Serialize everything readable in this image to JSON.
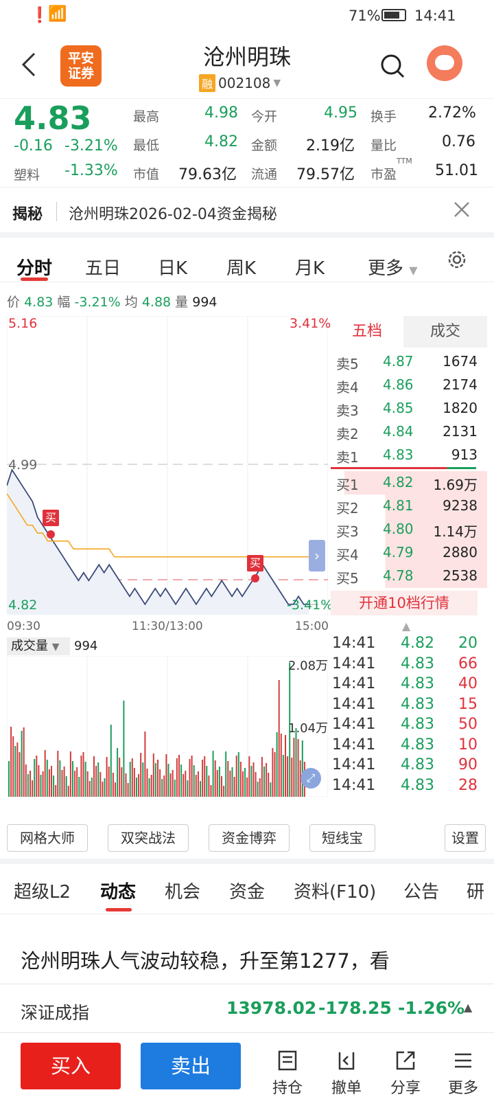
{
  "status_bar": {
    "battery": "71%",
    "time": "14:41"
  },
  "header": {
    "title": "沧州明珠",
    "rong": "融",
    "code": "002108",
    "logo_line1": "平安",
    "logo_line2": "证券"
  },
  "quote": {
    "price": "4.83",
    "change": "-0.16",
    "change_pct": "-3.21%",
    "sector": "塑料",
    "sector_pct": "-1.33%",
    "high_label": "最高",
    "high": "4.98",
    "low_label": "最低",
    "low": "4.82",
    "mcap_label": "市值",
    "mcap": "79.63亿",
    "open_label": "今开",
    "open": "4.95",
    "amount_label": "金额",
    "amount": "2.19亿",
    "float_label": "流通",
    "float": "79.57亿",
    "turnover_label": "换手",
    "turnover": "2.72%",
    "vol_ratio_label": "量比",
    "vol_ratio": "0.76",
    "pe_label": "市盈",
    "pe_sup": "TTM",
    "pe": "51.01"
  },
  "reveal": {
    "tag": "揭秘",
    "text": "沧州明珠2026-02-04资金揭秘"
  },
  "tabs": [
    "分时",
    "五日",
    "日K",
    "周K",
    "月K",
    "更多"
  ],
  "chart_info": {
    "price_label": "价",
    "price": "4.83",
    "amp_label": "幅",
    "amp": "-3.21%",
    "avg_label": "均",
    "avg": "4.88",
    "vol_label": "量",
    "vol": "994"
  },
  "chart_labels": {
    "top_price": "5.16",
    "top_pct": "3.41%",
    "mid_price": "4.99",
    "bottom_price": "4.82",
    "bottom_pct": "-3.41%",
    "t_start": "09:30",
    "t_mid": "11:30/13:00",
    "t_end": "15:00",
    "buy_tag": "买",
    "vol_title": "成交量",
    "vol_value": "994",
    "vol_max": "2.08万",
    "vol_mid": "1.04万"
  },
  "chart_data": {
    "type": "line",
    "series": [
      {
        "values": [
          4.97,
          4.99,
          4.98,
          4.97,
          4.96,
          4.95,
          4.93,
          4.92,
          4.91,
          4.9,
          4.89,
          4.88,
          4.87,
          4.86,
          4.85,
          4.86,
          4.85,
          4.86,
          4.87,
          4.86,
          4.87,
          4.86,
          4.85,
          4.84,
          4.83,
          4.84,
          4.83,
          4.82,
          4.83,
          4.84,
          4.83,
          4.84,
          4.83,
          4.82,
          4.83,
          4.84,
          4.83,
          4.82,
          4.83,
          4.84,
          4.83,
          4.84,
          4.85,
          4.84,
          4.83,
          4.84,
          4.83,
          4.84,
          4.85,
          4.86,
          4.87,
          4.86,
          4.85,
          4.84,
          4.83,
          4.82,
          4.82,
          4.83,
          4.82,
          4.82
        ]
      },
      {
        "values": [
          4.96,
          4.95,
          4.94,
          4.93,
          4.92,
          4.92,
          4.91,
          4.91,
          4.9,
          4.9,
          4.9,
          4.9,
          4.9,
          4.89,
          4.89,
          4.89,
          4.89,
          4.89,
          4.89,
          4.89,
          4.89,
          4.88,
          4.88,
          4.88,
          4.88,
          4.88,
          4.88,
          4.88,
          4.88,
          4.88,
          4.88,
          4.88,
          4.88,
          4.88,
          4.88,
          4.88,
          4.88,
          4.88,
          4.88,
          4.88,
          4.88,
          4.88,
          4.88,
          4.88,
          4.88,
          4.88,
          4.88,
          4.88,
          4.88,
          4.88,
          4.88,
          4.88,
          4.88,
          4.88,
          4.88,
          4.88,
          4.88,
          4.88,
          4.88,
          4.88
        ]
      }
    ],
    "ylim": [
      4.82,
      5.16
    ]
  },
  "order_book": {
    "tabs": [
      "五档",
      "成交"
    ],
    "sells": [
      {
        "label": "卖5",
        "price": "4.87",
        "vol": "1674"
      },
      {
        "label": "卖4",
        "price": "4.86",
        "vol": "2174"
      },
      {
        "label": "卖3",
        "price": "4.85",
        "vol": "1820"
      },
      {
        "label": "卖2",
        "price": "4.84",
        "vol": "2131"
      },
      {
        "label": "卖1",
        "price": "4.83",
        "vol": "913"
      }
    ],
    "buys": [
      {
        "label": "买1",
        "price": "4.82",
        "vol": "1.69万"
      },
      {
        "label": "买2",
        "price": "4.81",
        "vol": "9238"
      },
      {
        "label": "买3",
        "price": "4.80",
        "vol": "1.14万"
      },
      {
        "label": "买4",
        "price": "4.79",
        "vol": "2880"
      },
      {
        "label": "买5",
        "price": "4.78",
        "vol": "2538"
      }
    ],
    "open10": "开通10档行情"
  },
  "ticks": [
    {
      "time": "14:41",
      "price": "4.82",
      "vol": "20"
    },
    {
      "time": "14:41",
      "price": "4.83",
      "vol": "66"
    },
    {
      "time": "14:41",
      "price": "4.83",
      "vol": "40"
    },
    {
      "time": "14:41",
      "price": "4.83",
      "vol": "15"
    },
    {
      "time": "14:41",
      "price": "4.83",
      "vol": "50"
    },
    {
      "time": "14:41",
      "price": "4.83",
      "vol": "10"
    },
    {
      "time": "14:41",
      "price": "4.83",
      "vol": "90"
    },
    {
      "time": "14:41",
      "price": "4.83",
      "vol": "28"
    }
  ],
  "tools": [
    "网格大师",
    "双突战法",
    "资金博弈",
    "短线宝",
    "设置"
  ],
  "info_tabs": [
    "超级L2",
    "动态",
    "机会",
    "资金",
    "资料(F10)",
    "公告",
    "研"
  ],
  "news": {
    "headline": "沧州明珠人气波动较稳，升至第1277，看"
  },
  "index_bar": {
    "name": "深证成指",
    "value": "13978.02",
    "change": "-178.25",
    "pct": "-1.26%"
  },
  "bottom": {
    "buy": "买入",
    "sell": "卖出",
    "hold": "持仓",
    "cancel": "撤单",
    "share": "分享",
    "more": "更多"
  },
  "colors": {
    "up": "#e0313b",
    "down": "#1a9e5c",
    "accent": "#e53935",
    "sell_btn": "#1e7be0",
    "avg_line": "#f5a623"
  }
}
